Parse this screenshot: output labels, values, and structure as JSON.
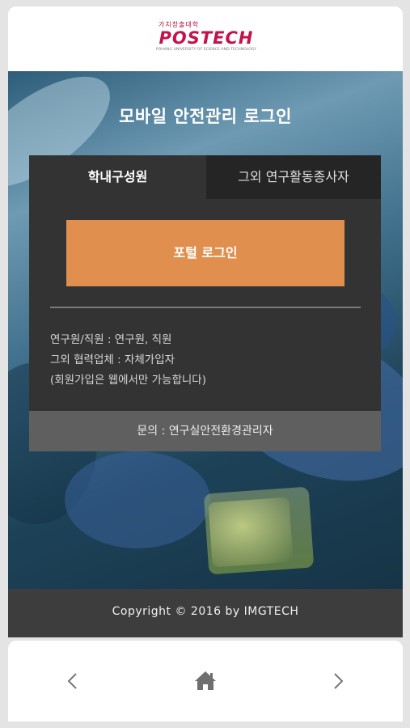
{
  "header": {
    "logo_slogan": "가치창출대학",
    "logo_word": "POSTECH",
    "logo_tagline": "POHANG UNIVERSITY OF SCIENCE AND TECHNOLOGY"
  },
  "hero": {
    "title": "모바일 안전관리 로그인"
  },
  "tabs": {
    "internal_label": "학내구성원",
    "external_label": "그외 연구활동종사자"
  },
  "login": {
    "portal_button": "포털 로그인"
  },
  "info": {
    "line1": "연구원/직원 : 연구원, 직원",
    "line2": "그외 협력업체 : 자체가입자",
    "line3": "(회원가입은 웹에서만 가능합니다)"
  },
  "contact": {
    "text": "문의 : 연구실안전환경관리자"
  },
  "footer": {
    "copyright": "Copyright © 2016 by IMGTECH"
  },
  "nav": {
    "prev_icon": "chevron-left-icon",
    "home_icon": "home-icon",
    "next_icon": "chevron-right-icon"
  },
  "colors": {
    "brand": "#c4124a",
    "accent_button": "#e08f4f",
    "card_bg": "#333333",
    "footer_bg": "#3d3d3d"
  }
}
